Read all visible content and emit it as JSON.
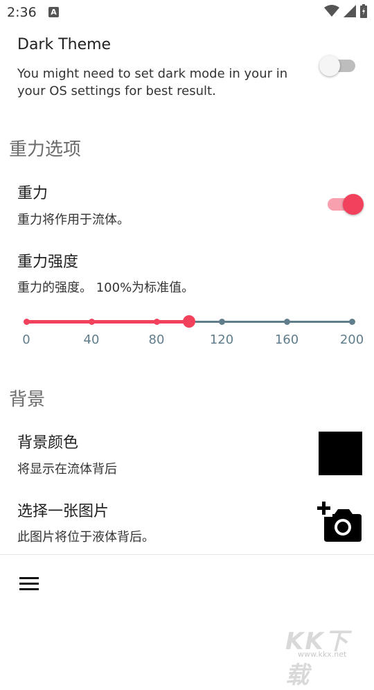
{
  "status_bar": {
    "time": "2:36",
    "notif_letter": "A"
  },
  "dark_theme": {
    "title": "Dark Theme",
    "summary_line1": "You might need to set dark mode in your in",
    "summary_line2": "your OS settings for best result.",
    "enabled": false
  },
  "gravity_section": {
    "header": "重力选项",
    "gravity": {
      "title": "重力",
      "summary": "重力将作用于流体。",
      "enabled": true
    },
    "strength": {
      "title": "重力强度",
      "summary": "重力的强度。 100%为标准值。",
      "value": 100,
      "min": 0,
      "max": 200,
      "ticks": [
        "0",
        "40",
        "80",
        "120",
        "160",
        "200"
      ]
    }
  },
  "background_section": {
    "header": "背景",
    "color": {
      "title": "背景颜色",
      "summary": "将显示在流体背后",
      "swatch": "#000000"
    },
    "image": {
      "title": "选择一张图片",
      "summary": "此图片将位于液体背后。",
      "icon": "add-photo-icon"
    }
  },
  "bottom_bar": {
    "icon": "menu-icon"
  },
  "watermark": {
    "main": "KK下载",
    "sub": "www.kkx.net"
  },
  "colors": {
    "accent": "#f2415c",
    "accent_light": "#f8a0ae",
    "slider_inactive": "#607d8b"
  }
}
